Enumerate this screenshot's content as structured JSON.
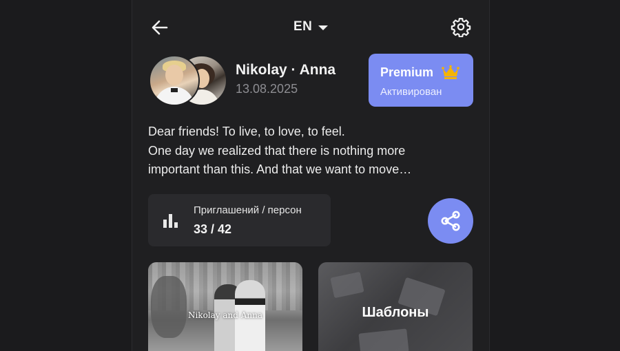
{
  "header": {
    "back_icon": "arrow-left-icon",
    "language": "EN",
    "settings_icon": "gear-icon"
  },
  "couple": {
    "names": "Nikolay · Anna",
    "date": "13.08.2025"
  },
  "premium": {
    "title": "Premium",
    "status": "Активирован",
    "icon": "crown-icon",
    "color": "#7b8cf2",
    "crown_color": "#f5b400"
  },
  "description": {
    "lines": [
      "Dear friends! To live, to love, to feel.",
      "One day we realized that there is nothing more",
      "important than this. And that we want to move…"
    ]
  },
  "stats": {
    "label": "Приглашений / персон",
    "value": "33 / 42",
    "icon": "bar-chart-icon"
  },
  "share": {
    "icon": "share-icon"
  },
  "cards": {
    "invitation_title": "Nikolay and Anna",
    "templates_label": "Шаблоны"
  }
}
